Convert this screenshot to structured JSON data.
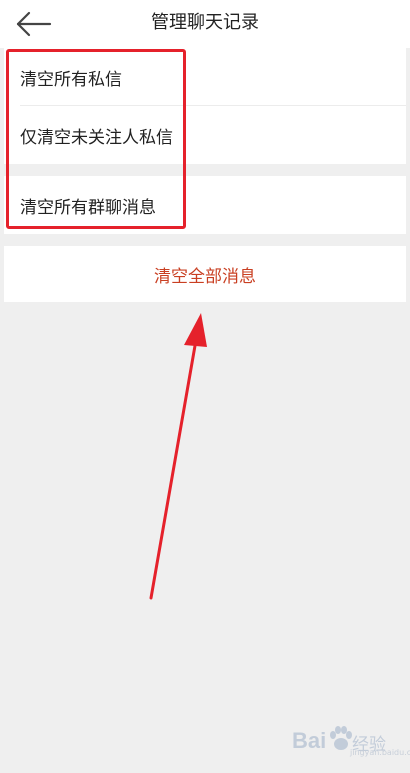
{
  "header": {
    "title": "管理聊天记录",
    "back_icon": "arrow-left-icon"
  },
  "menu": {
    "items": [
      {
        "label": "清空所有私信"
      },
      {
        "label": "仅清空未关注人私信"
      },
      {
        "label": "清空所有群聊消息"
      }
    ],
    "clear_all_label": "清空全部消息"
  },
  "annotations": {
    "highlight_color": "#e5212b",
    "arrow_color": "#e5212b"
  },
  "watermark": {
    "logo": "Bai",
    "text": "经验",
    "url": "jingyan.baidu.com"
  },
  "colors": {
    "background": "#efefef",
    "row_background": "#ffffff",
    "danger_text": "#c93f22"
  }
}
